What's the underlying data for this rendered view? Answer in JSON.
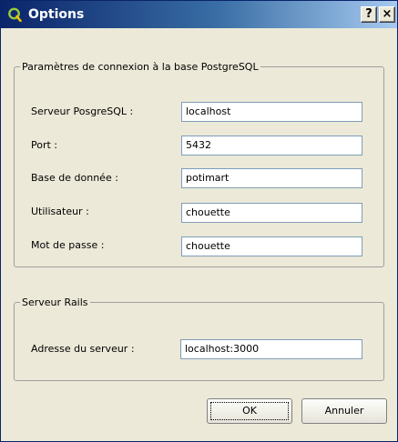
{
  "window": {
    "title": "Options",
    "help_label": "?",
    "close_label": "×",
    "app_icon": "qgis-icon"
  },
  "postgres_group": {
    "title": "Paramètres de connexion à la base PostgreSQL",
    "fields": [
      {
        "label": "Serveur PosgreSQL :",
        "value": "localhost"
      },
      {
        "label": "Port :",
        "value": "5432"
      },
      {
        "label": "Base de donnée :",
        "value": "potimart"
      },
      {
        "label": "Utilisateur :",
        "value": "chouette"
      },
      {
        "label": "Mot de passe :",
        "value": "chouette"
      }
    ]
  },
  "rails_group": {
    "title": "Serveur Rails",
    "field": {
      "label": "Adresse du serveur :",
      "value": "localhost:3000"
    }
  },
  "buttons": {
    "ok": "OK",
    "cancel": "Annuler"
  },
  "colors": {
    "titlebar_start": "#0a246a",
    "titlebar_end": "#a6caf0",
    "dialog_background": "#ece9d8"
  }
}
